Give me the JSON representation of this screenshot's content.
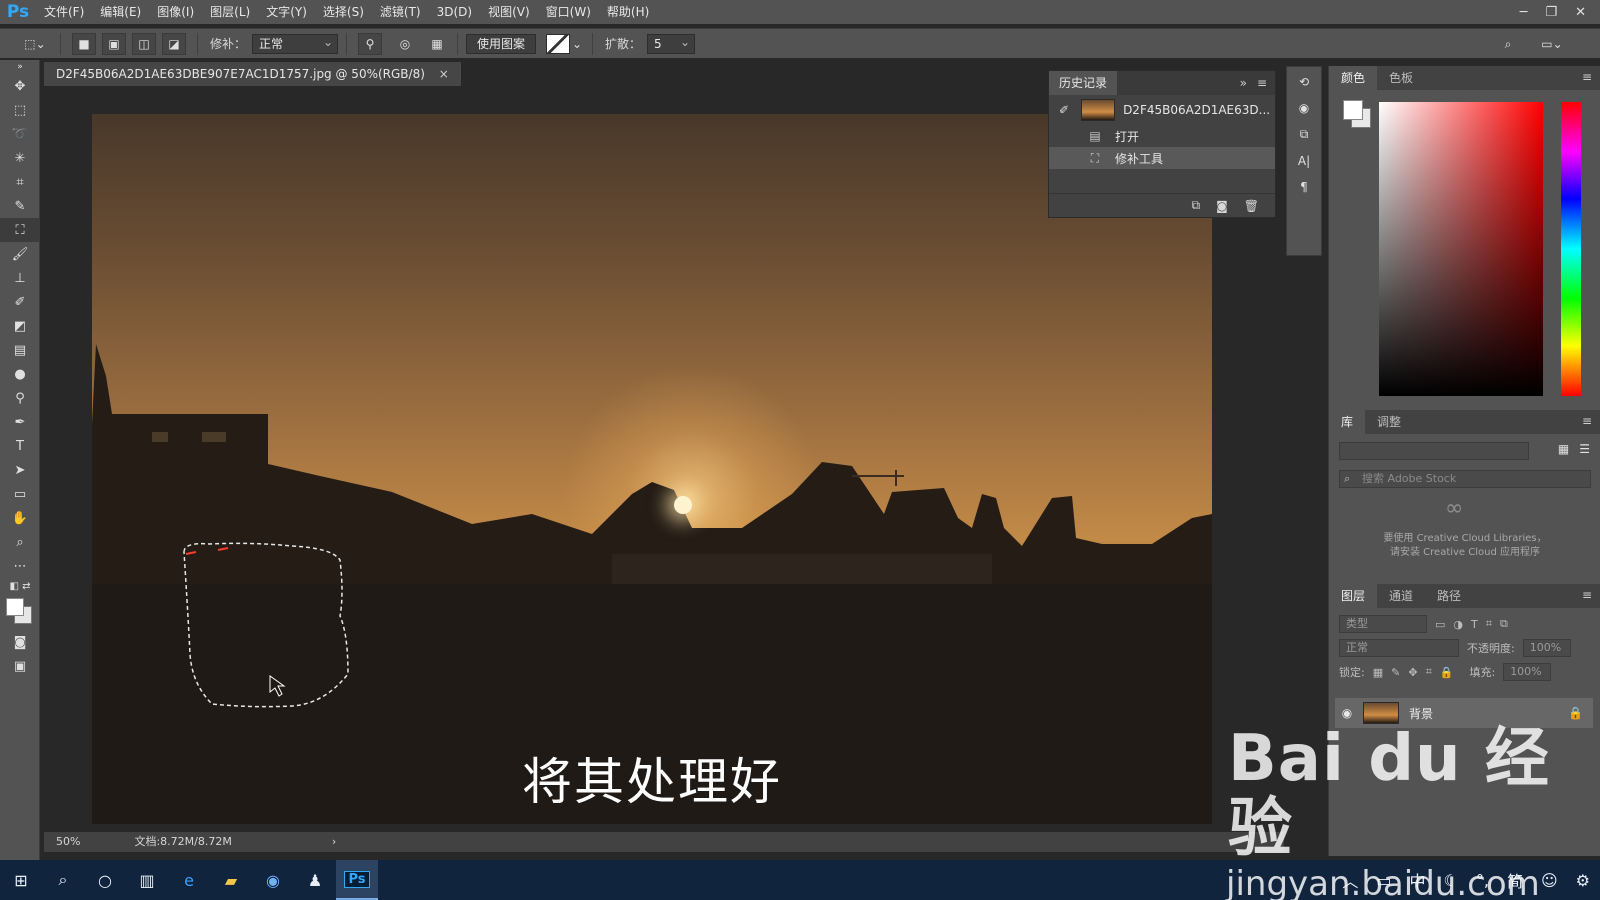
{
  "app": {
    "logo": "Ps"
  },
  "menu": [
    "文件(F)",
    "编辑(E)",
    "图像(I)",
    "图层(L)",
    "文字(Y)",
    "选择(S)",
    "滤镜(T)",
    "3D(D)",
    "视图(V)",
    "窗口(W)",
    "帮助(H)"
  ],
  "options": {
    "patch_label": "修补：",
    "patch_mode": "正常",
    "use_pattern": "使用图案",
    "diffusion_label": "扩散：",
    "diffusion_value": "5"
  },
  "document": {
    "tab_title": "D2F45B06A2D1AE63DBE907E7AC1D1757.jpg @ 50%(RGB/8)",
    "close": "×",
    "subtitle": "将其处理好",
    "zoom": "50%",
    "doc_size": "文档:8.72M/8.72M"
  },
  "history": {
    "title": "历史记录",
    "snapshot": "D2F45B06A2D1AE63D...",
    "items": [
      "打开",
      "修补工具"
    ]
  },
  "color_panel": {
    "tabs": [
      "颜色",
      "色板"
    ]
  },
  "library_panel": {
    "tabs": [
      "库",
      "调整"
    ],
    "search_placeholder": "搜索 Adobe Stock",
    "msg_line1": "要使用 Creative Cloud Libraries，",
    "msg_line2": "请安装 Creative Cloud 应用程序"
  },
  "layers_panel": {
    "tabs": [
      "图层",
      "通道",
      "路径"
    ],
    "filter_kind": "类型",
    "blend_mode": "正常",
    "opacity_label": "不透明度:",
    "opacity_value": "100%",
    "lock_label": "锁定:",
    "fill_label": "填充:",
    "fill_value": "100%",
    "layer_name": "背景"
  },
  "watermark": {
    "top": "Bai du 经验",
    "bottom": "jingyan.baidu.com"
  },
  "taskbar": {
    "tray_ime": "中",
    "tray_simplified": "简"
  }
}
